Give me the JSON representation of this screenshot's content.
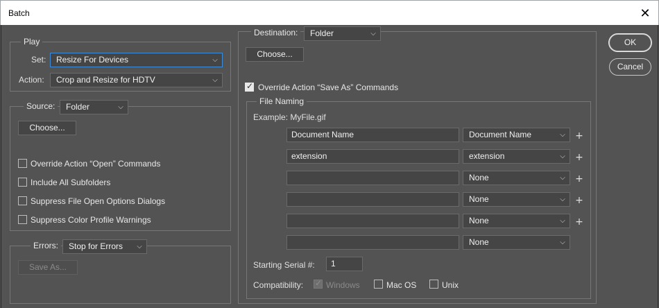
{
  "window": {
    "title": "Batch",
    "close_glyph": "✕"
  },
  "buttons": {
    "ok": "OK",
    "cancel": "Cancel"
  },
  "play": {
    "legend": "Play",
    "set_label": "Set:",
    "set_value": "Resize For Devices",
    "action_label": "Action:",
    "action_value": "Crop and Resize for HDTV"
  },
  "source": {
    "label": "Source:",
    "value": "Folder",
    "choose": "Choose...",
    "options": [
      {
        "label": "Override Action “Open” Commands",
        "checked": false
      },
      {
        "label": "Include All Subfolders",
        "checked": false
      },
      {
        "label": "Suppress File Open Options Dialogs",
        "checked": false
      },
      {
        "label": "Suppress Color Profile Warnings",
        "checked": false
      }
    ]
  },
  "errors": {
    "label": "Errors:",
    "value": "Stop for Errors",
    "save_as": "Save As..."
  },
  "destination": {
    "label": "Destination:",
    "value": "Folder",
    "choose": "Choose...",
    "override_label": "Override Action “Save As” Commands",
    "override_checked": true
  },
  "file_naming": {
    "legend": "File Naming",
    "example": "Example: MyFile.gif",
    "rows": [
      {
        "text": "Document Name",
        "select": "Document Name",
        "plus": "+"
      },
      {
        "text": "extension",
        "select": "extension",
        "plus": "+"
      },
      {
        "text": "",
        "select": "None",
        "plus": "+"
      },
      {
        "text": "",
        "select": "None",
        "plus": "+"
      },
      {
        "text": "",
        "select": "None",
        "plus": "+"
      },
      {
        "text": "",
        "select": "None",
        "plus": ""
      }
    ],
    "serial_label": "Starting Serial #:",
    "serial_value": "1",
    "compat_label": "Compatibility:",
    "compat": [
      {
        "label": "Windows",
        "checked": true,
        "disabled": true
      },
      {
        "label": "Mac OS",
        "checked": false,
        "disabled": false
      },
      {
        "label": "Unix",
        "checked": false,
        "disabled": false
      }
    ]
  },
  "icons": {
    "dropdown": "chevron-down-icon",
    "close": "close-icon",
    "checkbox_check": "checkmark-icon"
  },
  "colors": {
    "background": "#535353",
    "focus_border": "#3d8bd9",
    "titlebar": "#ffffff"
  }
}
